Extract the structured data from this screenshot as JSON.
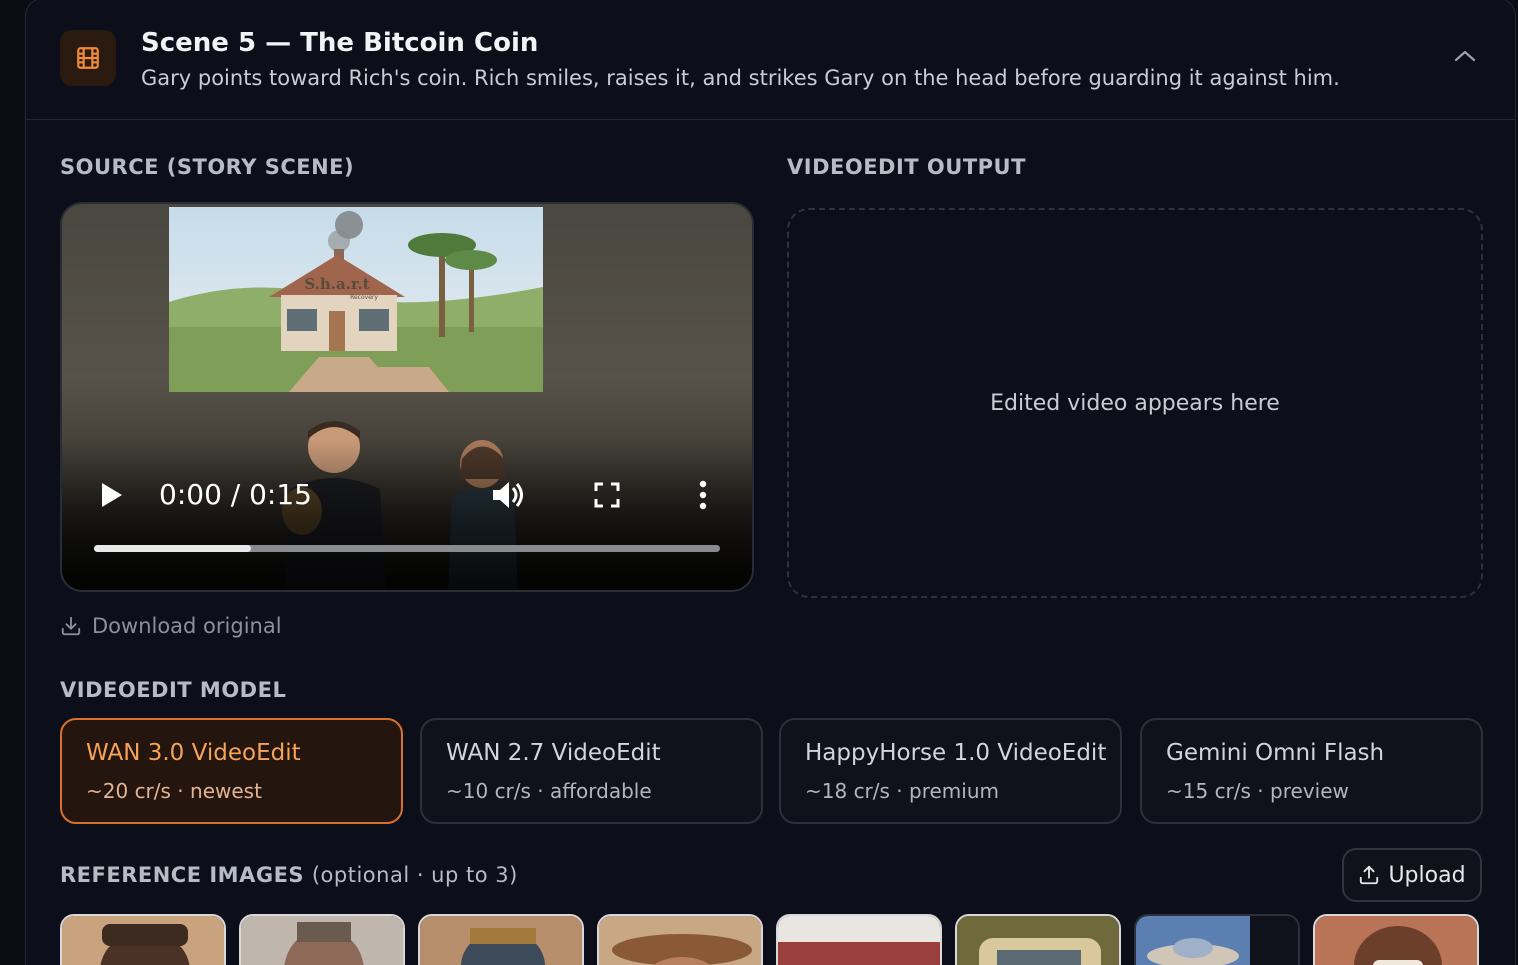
{
  "scene": {
    "title": "Scene 5 — The Bitcoin Coin",
    "description": "Gary points toward Rich's coin. Rich smiles, raises it, and strikes Gary on the head before guarding it against him."
  },
  "source": {
    "label": "SOURCE (STORY SCENE)",
    "time": "0:00 / 0:15",
    "progress_fraction": 0.25,
    "thumb_sign": "S.h.a.r.t",
    "thumb_sign_sub": "Recovery",
    "download_label": "Download original"
  },
  "output": {
    "label": "VIDEOEDIT OUTPUT",
    "placeholder": "Edited video appears here"
  },
  "models": {
    "label": "VIDEOEDIT MODEL",
    "items": [
      {
        "name": "WAN 3.0 VideoEdit",
        "sub": "~20 cr/s · newest",
        "selected": true
      },
      {
        "name": "WAN 2.7 VideoEdit",
        "sub": "~10 cr/s · affordable",
        "selected": false
      },
      {
        "name": "HappyHorse 1.0 VideoEdit",
        "sub": "~18 cr/s · premium",
        "selected": false
      },
      {
        "name": "Gemini Omni Flash",
        "sub": "~15 cr/s · preview",
        "selected": false
      }
    ]
  },
  "references": {
    "label": "REFERENCE IMAGES",
    "hint": "(optional · up to 3)",
    "upload_label": "Upload",
    "thumbs": [
      {
        "name": "ref-thumb-1",
        "bg": "#c9a27e"
      },
      {
        "name": "ref-thumb-2",
        "bg": "#bfb6ad"
      },
      {
        "name": "ref-thumb-3",
        "bg": "#b78e6c"
      },
      {
        "name": "ref-thumb-4",
        "bg": "#c7a784"
      },
      {
        "name": "ref-thumb-5",
        "bg": "#d9d6d2"
      },
      {
        "name": "ref-thumb-6",
        "bg": "#9a8f55"
      },
      {
        "name": "ref-thumb-7",
        "bg": "#5b7fb0"
      },
      {
        "name": "ref-thumb-8",
        "bg": "#b97357"
      }
    ]
  },
  "colors": {
    "accent": "#d9712d",
    "background": "#0c0f19"
  }
}
